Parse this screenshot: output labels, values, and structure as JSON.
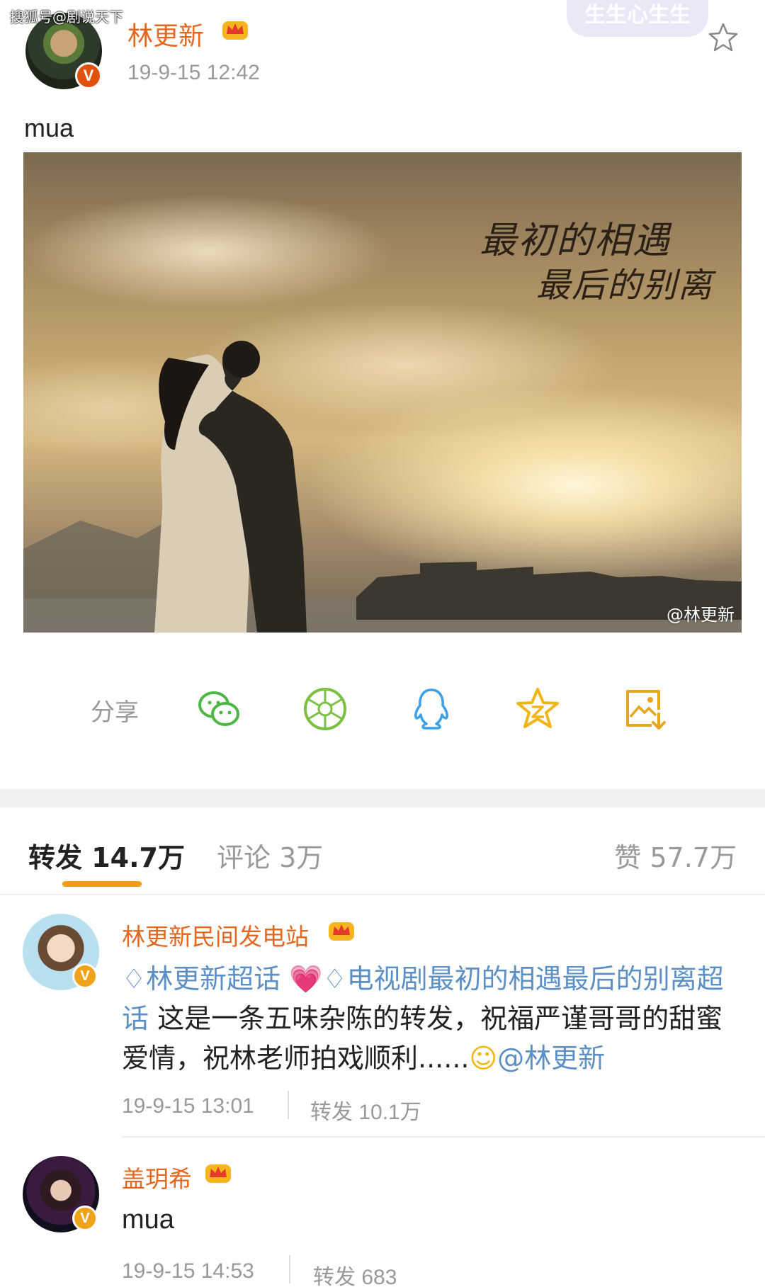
{
  "watermark": "搜狐号@剧说天下",
  "post": {
    "username": "林更新",
    "verified_label": "V",
    "timestamp": "19-9-15 12:42",
    "sticker_text": "生生心生生",
    "text": "mua",
    "photo": {
      "title_line1": "最初的相遇",
      "title_line2": "最后的别离",
      "watermark": "@林更新"
    }
  },
  "share": {
    "label": "分享",
    "targets": [
      "wechat-icon",
      "moments-icon",
      "qq-icon",
      "qzone-icon",
      "save-image-icon"
    ],
    "colors": {
      "wechat": "#4cb844",
      "moments": "#7ac143",
      "qq": "#3aa0e8",
      "qzone": "#f0b618",
      "save": "#e8a51e"
    }
  },
  "tabs": {
    "repost": "转发 14.7万",
    "comment": "评论 3万",
    "like": "赞 57.7万"
  },
  "reposts": [
    {
      "username": "林更新民间发电站",
      "tag1": "林更新超话",
      "tag2": "电视剧最初的相遇最后的别离超话",
      "body": " 这是一条五味杂陈的转发，祝福严谨哥哥的甜蜜爱情，祝林老师拍戏顺利......",
      "mention": "@林更新",
      "time": "19-9-15 13:01",
      "repost_count": "转发 10.1万"
    },
    {
      "username": "盖玥希",
      "body": "mua",
      "time": "19-9-15 14:53",
      "repost_count": "转发 683"
    }
  ],
  "colors": {
    "accent": "#f29b1a",
    "username": "#e5661d",
    "link": "#5b8fc6",
    "muted": "#999999"
  }
}
